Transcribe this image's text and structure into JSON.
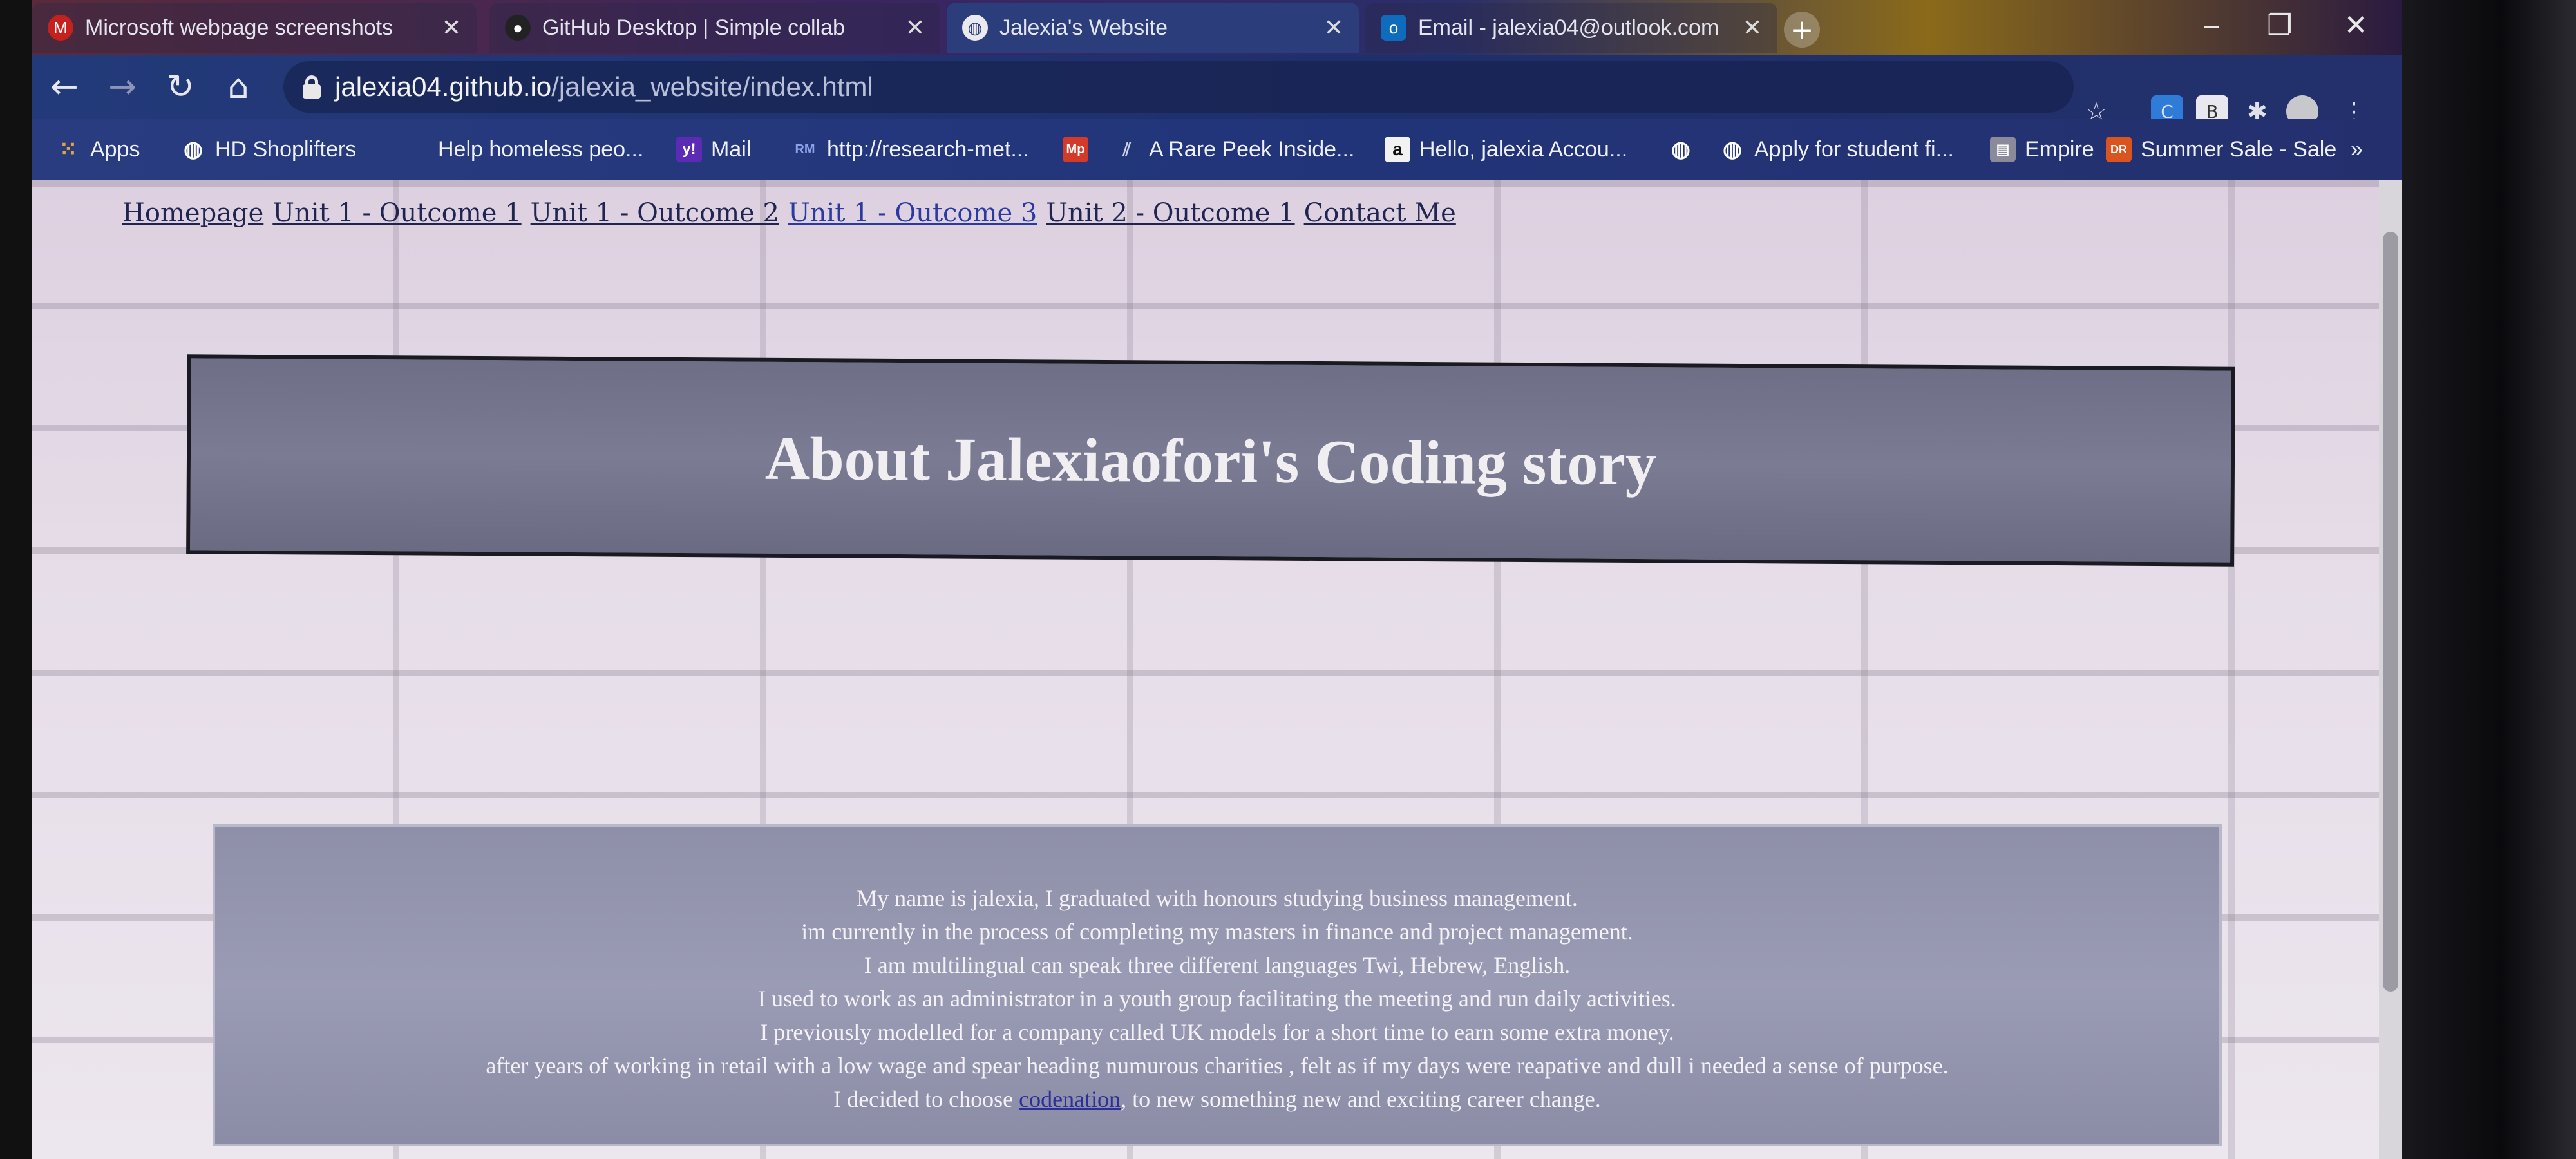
{
  "tabs": [
    {
      "label": "Microsoft webpage screenshots",
      "icon": "gmail-icon",
      "state": "inactive"
    },
    {
      "label": "GitHub Desktop | Simple collab",
      "icon": "github-icon",
      "state": "inactive"
    },
    {
      "label": "Jalexia's Website",
      "icon": "globe-icon",
      "state": "active"
    },
    {
      "label": "Email - jalexia04@outlook.com",
      "icon": "outlook-icon",
      "state": "inactive"
    }
  ],
  "window_controls": {
    "minimize": "‒",
    "maximize": "❐",
    "close": "✕"
  },
  "address": {
    "host": "jalexia04.github.io",
    "path": "/jalexia_website/index.html"
  },
  "bookmarks": [
    {
      "label": "Apps",
      "icon": "apps-grid-icon"
    },
    {
      "label": "HD Shoplifters",
      "icon": "globe-icon"
    },
    {
      "label": "Help homeless peo...",
      "icon": "none"
    },
    {
      "label": "Mail",
      "icon": "yahoo-mail-icon"
    },
    {
      "label": "http://research-met...",
      "icon": "rm-icon"
    },
    {
      "label": "",
      "icon": "mp-icon"
    },
    {
      "label": "A Rare Peek Inside...",
      "icon": "lines-icon"
    },
    {
      "label": "Hello, jalexia Accou...",
      "icon": "amazon-icon"
    },
    {
      "label": "",
      "icon": "globe-icon"
    },
    {
      "label": "Apply for student fi...",
      "icon": "globe-icon"
    },
    {
      "label": "Empire",
      "icon": "empire-icon"
    },
    {
      "label": "Summer Sale - Sale",
      "icon": "dr-icon"
    }
  ],
  "bookmarks_overflow": "»",
  "site_nav": [
    "Homepage",
    "Unit 1 - Outcome 1",
    "Unit 1 - Outcome 2",
    "Unit 1 - Outcome 3",
    "Unit 2 - Outcome 1",
    "Contact Me"
  ],
  "heading": "About Jalexiaofori's Coding story",
  "about_lines": [
    "My name is jalexia, I graduated with honours studying business management.",
    "im currently in the process of completing my masters in finance and project management.",
    "I am multilingual can speak three different languages Twi, Hebrew, English.",
    "I used to work as an administrator in a youth group facilitating the meeting and run daily activities.",
    "I previously modelled for a company called UK models for a short time to earn some extra money.",
    "after years of working in retail with a low wage and spear heading numurous charities , felt as if my days were reapative and dull i needed a sense of purpose."
  ],
  "about_last": {
    "before": "I decided to choose ",
    "link": "codenation",
    "after": ", to new something new and exciting career change."
  },
  "colors": {
    "active_tab": "#2b3d7a",
    "heading_box": "#74758c",
    "about_box": "#9293ac",
    "link": "#2c2e9a"
  }
}
